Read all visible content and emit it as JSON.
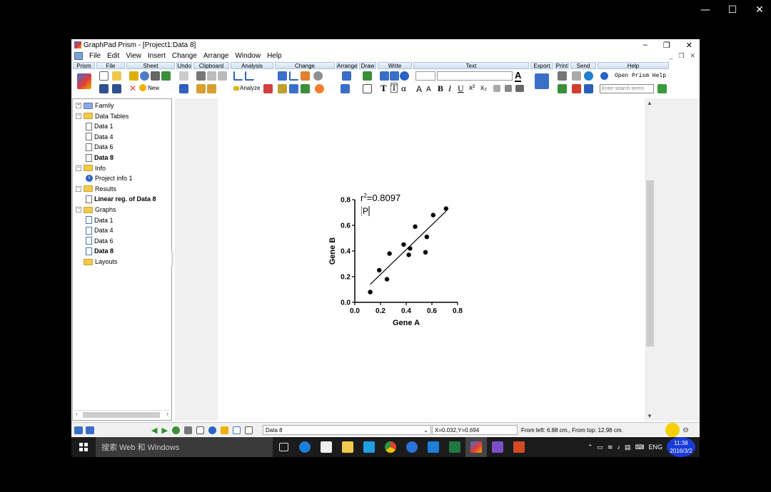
{
  "outer_window": {
    "minimize": "—",
    "maximize": "☐",
    "close": "✕"
  },
  "app": {
    "title": "GraphPad Prism - [Project1:Data 8]",
    "window_controls": {
      "minimize": "–",
      "restore": "❐",
      "close": "✕"
    },
    "menu": [
      "File",
      "Edit",
      "View",
      "Insert",
      "Change",
      "Arrange",
      "Window",
      "Help"
    ],
    "mdi_controls": {
      "minimize": "_",
      "restore": "❐",
      "close": "✕"
    }
  },
  "ribbon": {
    "groups": [
      "Prism",
      "File",
      "Sheet",
      "Undo",
      "Clipboard",
      "Analysis",
      "Change",
      "Arrange",
      "Draw",
      "Write",
      "Text",
      "Export",
      "Print",
      "Send",
      "Help"
    ],
    "new_label": "New",
    "analyze_label": "Analyze",
    "write_glyphs": {
      "t1": "T",
      "t2": "T",
      "alpha": "α"
    },
    "text_glyphs": {
      "grow": "A",
      "shrink": "A",
      "bold": "B",
      "italic": "I",
      "underline": "U",
      "superscript": "x²",
      "subscript": "x₂"
    },
    "help_link": "Open Prism Help",
    "search_placeholder": "Enter search terms"
  },
  "navigator": {
    "items": [
      {
        "label": "Family",
        "type": "family"
      },
      {
        "label": "Data Tables",
        "type": "folder"
      },
      {
        "label": "Data 1",
        "type": "sheet"
      },
      {
        "label": "Data 4",
        "type": "sheet"
      },
      {
        "label": "Data 6",
        "type": "sheet"
      },
      {
        "label": "Data 8",
        "type": "sheet",
        "selected": true
      },
      {
        "label": "Info",
        "type": "folder"
      },
      {
        "label": "Project info 1",
        "type": "info"
      },
      {
        "label": "Results",
        "type": "folder"
      },
      {
        "label": "Linear reg. of Data 8",
        "type": "sheet",
        "selected": true
      },
      {
        "label": "Graphs",
        "type": "folder"
      },
      {
        "label": "Data 1",
        "type": "graph"
      },
      {
        "label": "Data 4",
        "type": "graph"
      },
      {
        "label": "Data 6",
        "type": "graph"
      },
      {
        "label": "Data 8",
        "type": "graph",
        "selected": true
      },
      {
        "label": "Layouts",
        "type": "folder"
      }
    ]
  },
  "graph": {
    "annotation_r2": "r",
    "annotation_r2_sup": "2",
    "annotation_r2_value": "=0.8097",
    "annotation_p": "P",
    "chart_data": {
      "type": "scatter",
      "xlabel": "Gene A",
      "ylabel": "Gene B",
      "xlim": [
        0,
        0.8
      ],
      "ylim": [
        0,
        0.8
      ],
      "xticks": [
        "0.0",
        "0.2",
        "0.4",
        "0.6",
        "0.8"
      ],
      "yticks": [
        "0.0",
        "0.2",
        "0.4",
        "0.6",
        "0.8"
      ],
      "points": [
        {
          "x": 0.12,
          "y": 0.08
        },
        {
          "x": 0.19,
          "y": 0.25
        },
        {
          "x": 0.25,
          "y": 0.18
        },
        {
          "x": 0.27,
          "y": 0.38
        },
        {
          "x": 0.38,
          "y": 0.45
        },
        {
          "x": 0.42,
          "y": 0.37
        },
        {
          "x": 0.43,
          "y": 0.42
        },
        {
          "x": 0.47,
          "y": 0.59
        },
        {
          "x": 0.55,
          "y": 0.39
        },
        {
          "x": 0.56,
          "y": 0.51
        },
        {
          "x": 0.61,
          "y": 0.68
        },
        {
          "x": 0.71,
          "y": 0.73
        }
      ],
      "regression_line": {
        "x": [
          0.12,
          0.71
        ],
        "y": [
          0.14,
          0.71
        ]
      }
    }
  },
  "statusbar": {
    "sheet_name": "Data 8",
    "coords": "X=0.032,Y=0.694",
    "position": "From left: 6.88 cm., From top: 12.98 cm."
  },
  "taskbar": {
    "search_placeholder": "搜索 Web 和 Windows",
    "tray_lang": "ENG",
    "time": "11:38",
    "date": "2016/3/2"
  }
}
